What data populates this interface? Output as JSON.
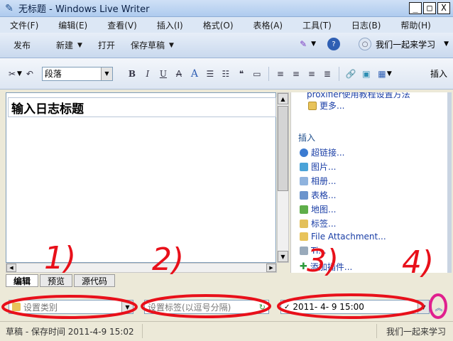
{
  "window": {
    "title": "无标题 - Windows Live Writer",
    "controls": [
      "_",
      "□",
      "X"
    ]
  },
  "menu": [
    "文件(F)",
    "编辑(E)",
    "查看(V)",
    "插入(I)",
    "格式(O)",
    "表格(A)",
    "工具(T)",
    "日志(B)",
    "帮助(H)"
  ],
  "commands": {
    "publish": "发布",
    "new": "新建",
    "open": "打开",
    "save_draft": "保存草稿",
    "blog_name": "我们一起来学习"
  },
  "format_toolbar": {
    "paragraph_value": "段落",
    "insert_label": "插入"
  },
  "editor": {
    "title_placeholder": "输入日志标题"
  },
  "sidebar": {
    "top_link_partial": "proxifier使用教程设置方法",
    "more_link": "更多...",
    "insert_heading": "插入",
    "insert_items": [
      {
        "label": "超链接...",
        "icon": "link-icon"
      },
      {
        "label": "图片...",
        "icon": "picture-icon"
      },
      {
        "label": "相册...",
        "icon": "album-icon"
      },
      {
        "label": "表格...",
        "icon": "table-icon"
      },
      {
        "label": "地图...",
        "icon": "map-icon"
      },
      {
        "label": "标签...",
        "icon": "tag-icon"
      },
      {
        "label": "File Attachment...",
        "icon": "attachment-icon"
      },
      {
        "label": "Ti...",
        "icon": "twitter-icon"
      },
      {
        "label": "添加插件...",
        "icon": "add-plugin-icon"
      }
    ]
  },
  "tabs": [
    "编辑",
    "预览",
    "源代码"
  ],
  "properties": {
    "category_placeholder": "设置类别",
    "tags_placeholder": "设置标签(以逗号分隔)",
    "publish_date": "2011- 4- 9 15:00"
  },
  "status": {
    "left": "草稿 - 保存时间 2011-4-9 15:02",
    "right": "我们一起来学习"
  },
  "annotations": {
    "labels": [
      "1)",
      "2)",
      "3)",
      "4)"
    ],
    "colors": {
      "red": "#e8101a",
      "magenta": "#e0208e"
    }
  }
}
